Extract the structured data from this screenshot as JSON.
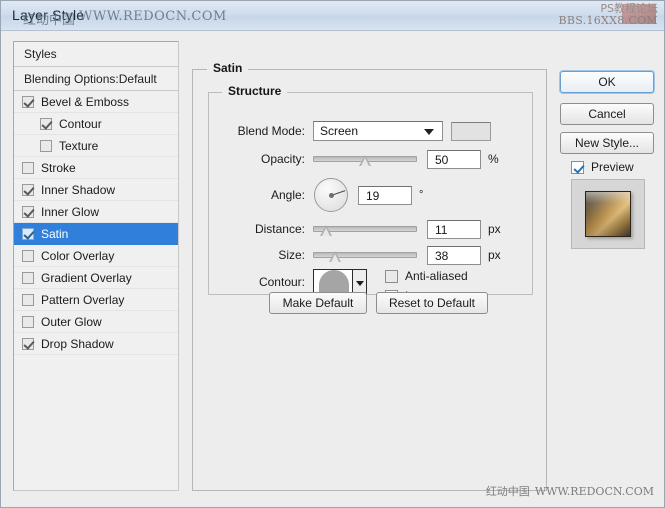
{
  "window": {
    "title": "Layer Style"
  },
  "watermarks": {
    "title_overlay_cn": "红动中国",
    "title_overlay_url": "WWW.REDOCN.COM",
    "top_right_line1": "PS教程论坛",
    "top_right_line2": "BBS.16XX8.COM",
    "bottom_cn": "红动中国",
    "bottom_url": "WWW.REDOCN.COM"
  },
  "styles_panel": {
    "header": "Styles",
    "blending_options": "Blending Options:Default",
    "items": [
      {
        "label": "Bevel & Emboss",
        "checked": true,
        "indent": false,
        "selected": false
      },
      {
        "label": "Contour",
        "checked": true,
        "indent": true,
        "selected": false
      },
      {
        "label": "Texture",
        "checked": false,
        "indent": true,
        "selected": false
      },
      {
        "label": "Stroke",
        "checked": false,
        "indent": false,
        "selected": false
      },
      {
        "label": "Inner Shadow",
        "checked": true,
        "indent": false,
        "selected": false
      },
      {
        "label": "Inner Glow",
        "checked": true,
        "indent": false,
        "selected": false
      },
      {
        "label": "Satin",
        "checked": true,
        "indent": false,
        "selected": true
      },
      {
        "label": "Color Overlay",
        "checked": false,
        "indent": false,
        "selected": false
      },
      {
        "label": "Gradient Overlay",
        "checked": false,
        "indent": false,
        "selected": false
      },
      {
        "label": "Pattern Overlay",
        "checked": false,
        "indent": false,
        "selected": false
      },
      {
        "label": "Outer Glow",
        "checked": false,
        "indent": false,
        "selected": false
      },
      {
        "label": "Drop Shadow",
        "checked": true,
        "indent": false,
        "selected": false
      }
    ]
  },
  "satin": {
    "group_title": "Satin",
    "structure_title": "Structure",
    "blend_mode": {
      "label": "Blend Mode:",
      "value": "Screen",
      "swatch_color": "#e2e2e2"
    },
    "opacity": {
      "label": "Opacity:",
      "value": "50",
      "unit": "%",
      "percent": 50
    },
    "angle": {
      "label": "Angle:",
      "value": "19",
      "unit": "°",
      "degrees": 19
    },
    "distance": {
      "label": "Distance:",
      "value": "11",
      "unit": "px",
      "percent": 8
    },
    "size": {
      "label": "Size:",
      "value": "38",
      "unit": "px",
      "percent": 17
    },
    "contour": {
      "label": "Contour:"
    },
    "anti_aliased": {
      "label": "Anti-aliased",
      "checked": false
    },
    "invert": {
      "label": "Invert",
      "checked": true
    },
    "make_default": "Make Default",
    "reset_to_default": "Reset to Default"
  },
  "buttons": {
    "ok": "OK",
    "cancel": "Cancel",
    "new_style": "New Style..."
  },
  "preview": {
    "label": "Preview",
    "checked": true
  },
  "colors": {
    "dialog_bg": "#ededed",
    "titlebar": "#cfdcec",
    "selection": "#2f7fdb",
    "accent_check": "#2f6fb5"
  }
}
